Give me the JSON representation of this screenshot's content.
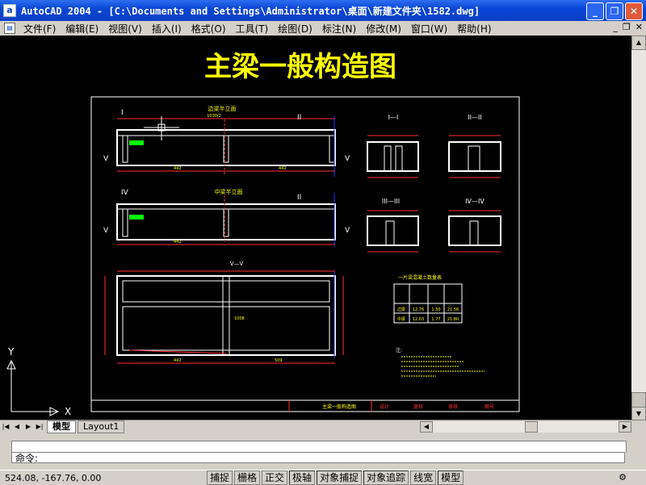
{
  "window": {
    "title": "AutoCAD 2004 - [C:\\Documents and Settings\\Administrator\\桌面\\新建文件夹\\1582.dwg]",
    "app_icon": "a"
  },
  "menu": [
    "文件(F)",
    "编辑(E)",
    "视图(V)",
    "插入(I)",
    "格式(O)",
    "工具(T)",
    "绘图(D)",
    "标注(N)",
    "修改(M)",
    "窗口(W)",
    "帮助(H)"
  ],
  "drawing": {
    "main_title": "主梁一般构造图",
    "elev1_title": "边梁半立面",
    "elev2_title": "中梁半立面",
    "plan_title": "V—V",
    "sections": [
      "I—I",
      "II—II",
      "III—III",
      "IV—IV"
    ],
    "mark_I": "I",
    "mark_II": "II",
    "mark_IV": "IV",
    "mark_V": "V",
    "dim_1030": "1030/2",
    "dims_elev": [
      "442",
      "442"
    ],
    "dims_plan": [
      "442",
      "509"
    ],
    "dim_1008": "1008",
    "table_title": "一片梁混凝土数量表",
    "table_rows": [
      {
        "name": "边梁",
        "a": "12.76",
        "b": "1.50",
        "c": "21.56"
      },
      {
        "name": "中梁",
        "a": "12.03",
        "b": "1.77",
        "c": "21.80"
      }
    ],
    "notes_label": "注:",
    "titleblock": [
      "主梁一般构造图",
      "设计",
      "复核",
      "审核",
      "图号"
    ]
  },
  "ucs": {
    "x": "X",
    "y": "Y"
  },
  "tabs": [
    "模型",
    "Layout1"
  ],
  "command": {
    "prompt": "命令:"
  },
  "status": {
    "coords": "524.08,  -167.76,  0.00",
    "buttons": [
      "捕捉",
      "栅格",
      "正交",
      "极轴",
      "对象捕捉",
      "对象追踪",
      "线宽",
      "模型"
    ]
  }
}
